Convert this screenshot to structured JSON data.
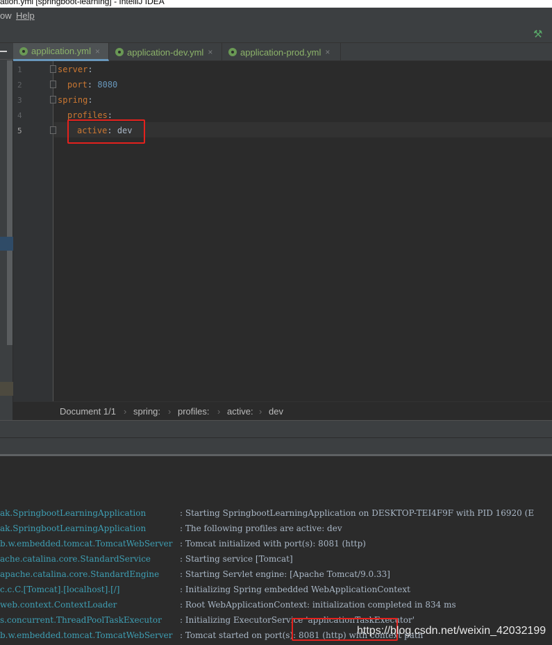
{
  "window": {
    "title": "ation.yml [springboot-learning] - IntelliJ IDEA"
  },
  "menu": {
    "items": [
      "ow",
      "Help"
    ]
  },
  "toolbar": {
    "build_icon": "hammer-icon"
  },
  "tabs": [
    {
      "label": "application.yml",
      "active": true,
      "icon": "yaml-spring-icon",
      "close": "×"
    },
    {
      "label": "application-dev.yml",
      "active": false,
      "icon": "yaml-spring-icon",
      "close": "×"
    },
    {
      "label": "application-prod.yml",
      "active": false,
      "icon": "yaml-spring-icon",
      "close": "×"
    }
  ],
  "editor": {
    "line_numbers": [
      "1",
      "2",
      "3",
      "4",
      "5"
    ],
    "current_line": 5,
    "lines": [
      {
        "key": "server",
        "colon": ":",
        "value": ""
      },
      {
        "key": "port",
        "colon": ":",
        "value": "8080"
      },
      {
        "key": "spring",
        "colon": ":",
        "value": ""
      },
      {
        "key": "profiles",
        "colon": ":",
        "value": ""
      },
      {
        "key": "active",
        "colon": ":",
        "value": "dev"
      }
    ]
  },
  "breadcrumb": {
    "items": [
      "Document 1/1",
      "spring:",
      "profiles:",
      "active:",
      "dev"
    ],
    "separator": "›"
  },
  "console": {
    "rows": [
      {
        "logger": "ak.SpringbootLearningApplication",
        "message": ": Starting SpringbootLearningApplication on DESKTOP-TEI4F9F with PID 16920 (E"
      },
      {
        "logger": "ak.SpringbootLearningApplication",
        "message": ": The following profiles are active: dev"
      },
      {
        "logger": "b.w.embedded.tomcat.TomcatWebServer",
        "message": ": Tomcat initialized with port(s): 8081 (http)"
      },
      {
        "logger": "ache.catalina.core.StandardService",
        "message": ": Starting service [Tomcat]"
      },
      {
        "logger": "apache.catalina.core.StandardEngine",
        "message": ": Starting Servlet engine: [Apache Tomcat/9.0.33]"
      },
      {
        "logger": "c.c.C.[Tomcat].[localhost].[/]",
        "message": ": Initializing Spring embedded WebApplicationContext"
      },
      {
        "logger": "web.context.ContextLoader",
        "message": ": Root WebApplicationContext: initialization completed in 834 ms"
      },
      {
        "logger": "s.concurrent.ThreadPoolTaskExecutor",
        "message": ": Initializing ExecutorService 'applicationTaskExecutor'"
      },
      {
        "logger": "b.w.embedded.tomcat.TomcatWebServer",
        "message": ": Tomcat started on port(s): 8081 (http) with context path"
      }
    ]
  },
  "watermark": "https://blog.csdn.net/weixin_42032199",
  "colors": {
    "editor_bg": "#2b2b2b",
    "keyword": "#cc7832",
    "number": "#6897bb",
    "logger": "#3e9fb4",
    "highlight_box": "#e5211d",
    "tab_label": "#8cb36a"
  }
}
